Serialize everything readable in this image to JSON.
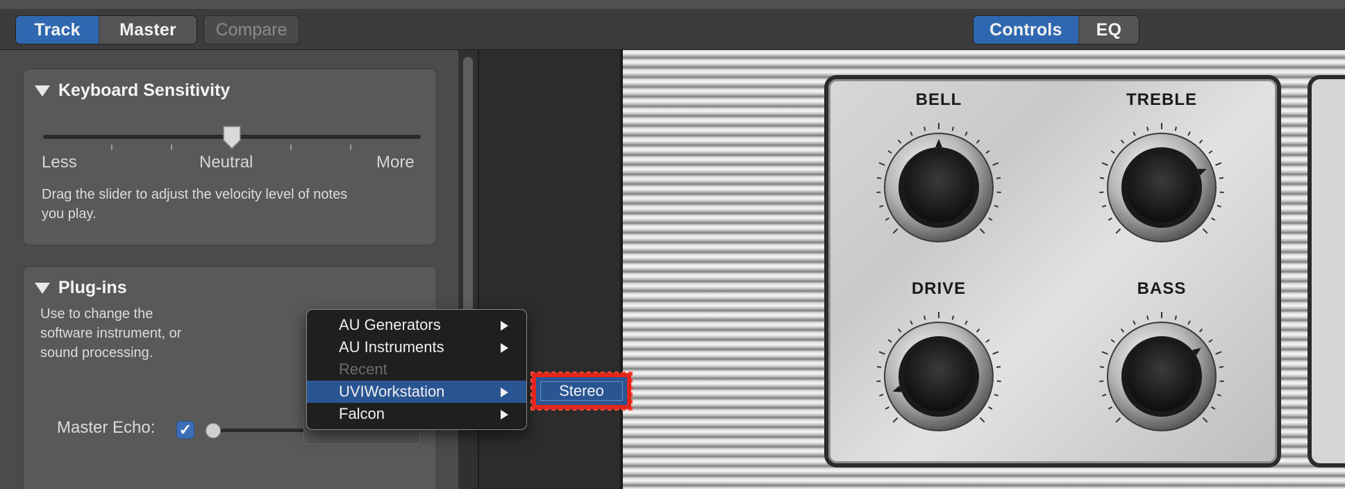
{
  "toolbar": {
    "tabs": [
      {
        "label": "Track",
        "active": true
      },
      {
        "label": "Master",
        "active": false
      }
    ],
    "compare_label": "Compare",
    "view_tabs": [
      {
        "label": "Controls",
        "active": true
      },
      {
        "label": "EQ",
        "active": false
      }
    ]
  },
  "keyboard_sensitivity": {
    "title": "Keyboard Sensitivity",
    "slider_value": 0.5,
    "labels": {
      "left": "Less",
      "center": "Neutral",
      "right": "More"
    },
    "description_line1": "Drag the slider to adjust the velocity level of notes",
    "description_line2": "you play."
  },
  "plugins": {
    "title": "Plug-ins",
    "description_line1": "Use to change the",
    "description_line2": "software instrument, or",
    "description_line3": "sound processing."
  },
  "master_echo": {
    "label": "Master Echo:",
    "checked": true,
    "check_glyph": "✓",
    "slider_value": 0.0
  },
  "context_menu": {
    "items": [
      {
        "label": "AU Generators",
        "has_submenu": true,
        "state": "normal"
      },
      {
        "label": "AU Instruments",
        "has_submenu": true,
        "state": "normal"
      },
      {
        "label": "Recent",
        "has_submenu": false,
        "state": "disabled"
      },
      {
        "label": "UVIWorkstation",
        "has_submenu": true,
        "state": "selected"
      },
      {
        "label": "Falcon",
        "has_submenu": true,
        "state": "normal"
      }
    ],
    "submenu": {
      "label": "Stereo",
      "highlight_color": "#e3261c"
    }
  },
  "amp": {
    "knobs": [
      {
        "label": "BELL",
        "value": 0.5
      },
      {
        "label": "TREBLE",
        "value": 0.75
      },
      {
        "label": "DRIVE",
        "value": 0.1
      },
      {
        "label": "BASS",
        "value": 0.7
      }
    ]
  },
  "colors": {
    "accent": "#2f68b0",
    "menu_selected": "#2a5593",
    "highlight_box": "#e3261c"
  }
}
